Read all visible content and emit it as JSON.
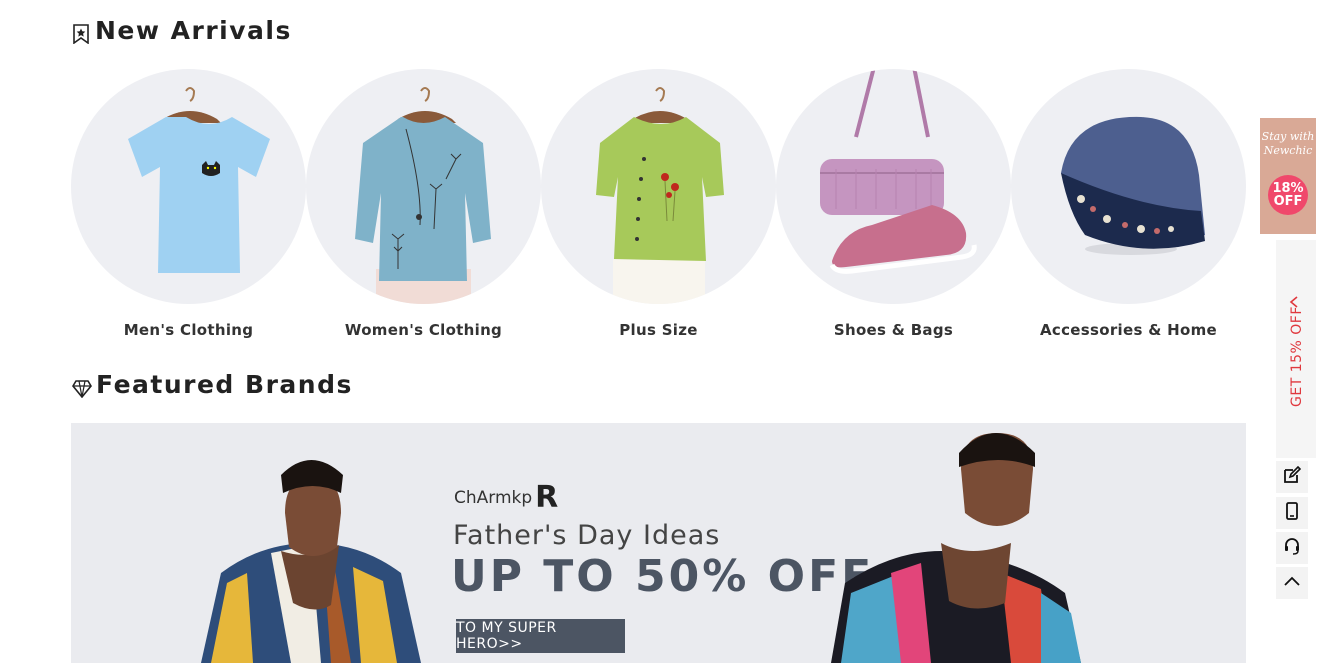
{
  "new_arrivals": {
    "title": "New Arrivals",
    "categories": [
      {
        "label": "Men's Clothing"
      },
      {
        "label": "Women's Clothing"
      },
      {
        "label": "Plus Size"
      },
      {
        "label": "Shoes & Bags"
      },
      {
        "label": "Accessories & Home"
      }
    ]
  },
  "featured_brands": {
    "title": "Featured Brands",
    "banner": {
      "brand_text": "ChArmkp",
      "brand_mark": "R",
      "subtitle": "Father's Day Ideas",
      "headline": "UP TO 50% OFF",
      "cta": "TO MY SUPER HERO>>"
    }
  },
  "side_promo": {
    "card_line1": "Stay with",
    "card_line2": "Newchic",
    "card_discount_num": "18%",
    "card_discount_word": "OFF",
    "tab_text": "GET 15% OFF"
  },
  "colors": {
    "accent_red": "#e0383e",
    "cta_bg": "#4c5563",
    "circle_bg": "#eeeff3"
  }
}
